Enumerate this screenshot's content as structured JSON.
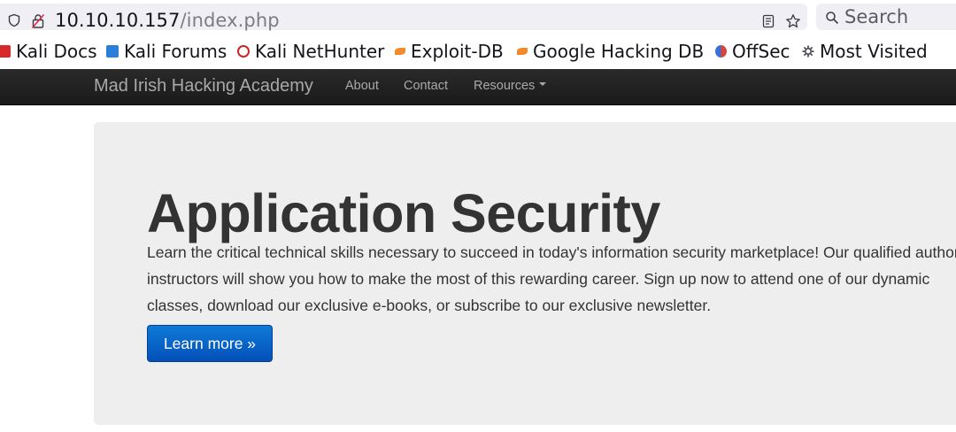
{
  "browser": {
    "url_host": "10.10.10.157",
    "url_path": "/index.php",
    "search_placeholder": "Search"
  },
  "bookmarks": [
    {
      "label": "Kali Docs",
      "icon": "kali-docs-icon"
    },
    {
      "label": "Kali Forums",
      "icon": "kali-forums-icon"
    },
    {
      "label": "Kali NetHunter",
      "icon": "nethunter-icon"
    },
    {
      "label": "Exploit-DB",
      "icon": "exploit-db-icon"
    },
    {
      "label": "Google Hacking DB",
      "icon": "ghdb-icon"
    },
    {
      "label": "OffSec",
      "icon": "offsec-icon"
    },
    {
      "label": "Most Visited",
      "icon": "gear-icon"
    }
  ],
  "navbar": {
    "brand": "Mad Irish Hacking Academy",
    "links": [
      "About",
      "Contact",
      "Resources"
    ]
  },
  "hero": {
    "title": "Application Security",
    "lines": [
      "Learn the critical technical skills necessary to succeed in today's information security marketplace! Our qualified authorized",
      "instructors will show you how to make the most of this rewarding career. Sign up now to attend one of our dynamic",
      "classes, download our exclusive e-books, or subscribe to our exclusive newsletter."
    ],
    "button": "Learn more »"
  },
  "colors": {
    "navbar_bg": "#222222",
    "hero_bg": "#eeeeee",
    "button_bg": "#0a66cc"
  }
}
